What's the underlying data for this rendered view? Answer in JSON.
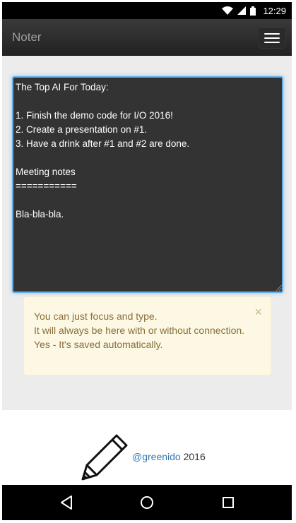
{
  "status_bar": {
    "time": "12:29",
    "icons": [
      "wifi-icon",
      "signal-icon",
      "battery-icon"
    ]
  },
  "app_bar": {
    "title": "Noter",
    "menu_icon": "hamburger-menu-icon"
  },
  "editor": {
    "content": "The Top AI For Today:\n\n1. Finish the demo code for I/O 2016!\n2. Create a presentation on #1.\n3. Have a drink after #1 and #2 are done.\n\nMeeting notes\n===========\n\nBla-bla-bla."
  },
  "alert": {
    "lines": [
      "You can just focus and type.",
      "It will always be here with or without connection.",
      "Yes - It's saved automatically."
    ],
    "close_symbol": "×"
  },
  "footer": {
    "link_text": "@greenido",
    "year": "2016",
    "icon": "pencil-icon"
  },
  "nav_bar": {
    "icons": [
      "back-icon",
      "home-icon",
      "recents-icon"
    ]
  },
  "colors": {
    "accent_focus": "#66afe9",
    "alert_bg": "#fcf8e3",
    "alert_text": "#8a6d3b",
    "link": "#337ab7",
    "editor_bg": "#333333"
  }
}
